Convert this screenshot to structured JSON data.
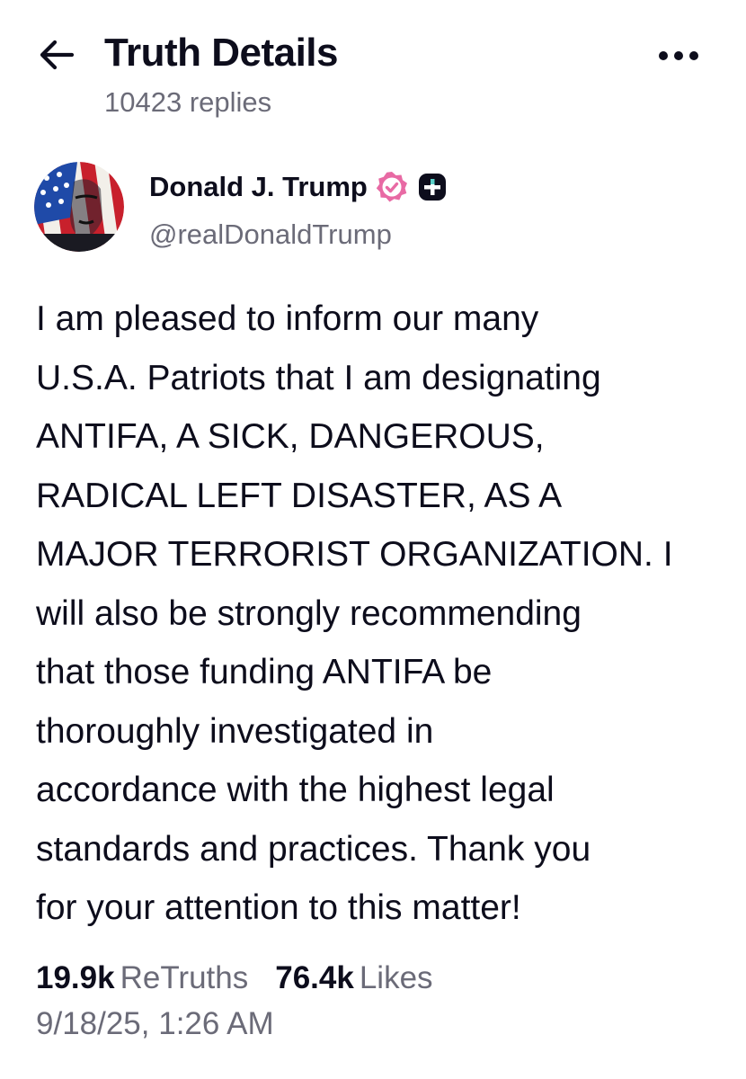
{
  "header": {
    "title": "Truth Details",
    "subtitle": "10423 replies",
    "back_icon": "arrow-left-icon",
    "more_icon": "more-horizontal-icon"
  },
  "author": {
    "name": "Donald J. Trump",
    "handle": "@realDonaldTrump",
    "verified_icon": "verified-badge-icon",
    "badge_icon": "plus-badge-icon",
    "verified_color": "#e85d9e"
  },
  "post": {
    "lines": [
      "I am pleased to inform our many",
      "U.S.A. Patriots that I am designating",
      "ANTIFA, A SICK, DANGEROUS,",
      "RADICAL LEFT DISASTER, AS A",
      "MAJOR TERRORIST ORGANIZATION. I",
      "will also be strongly recommending",
      "that those funding ANTIFA be",
      "thoroughly investigated in",
      "accordance with the highest legal",
      "standards and practices. Thank you",
      "for your attention to this matter!"
    ]
  },
  "stats": {
    "retruths_count": "19.9k",
    "retruths_label": "ReTruths",
    "likes_count": "76.4k",
    "likes_label": "Likes"
  },
  "timestamp": "9/18/25, 1:26 AM",
  "colors": {
    "text_primary": "#0d0d1c",
    "text_secondary": "#6b6b78",
    "background": "#ffffff"
  }
}
